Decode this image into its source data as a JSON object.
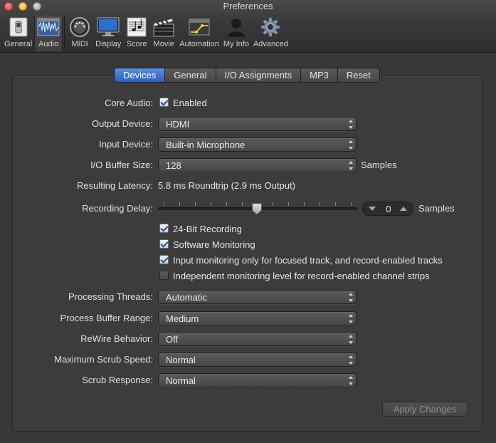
{
  "window": {
    "title": "Preferences"
  },
  "toolbar": {
    "items": [
      {
        "label": "General",
        "icon": "switch-icon"
      },
      {
        "label": "Audio",
        "icon": "audio-waveform-icon"
      },
      {
        "label": "MIDI",
        "icon": "midi-connector-icon"
      },
      {
        "label": "Display",
        "icon": "monitor-icon"
      },
      {
        "label": "Score",
        "icon": "music-score-icon"
      },
      {
        "label": "Movie",
        "icon": "clapperboard-icon"
      },
      {
        "label": "Automation",
        "icon": "automation-curve-icon"
      },
      {
        "label": "My Info",
        "icon": "person-icon"
      },
      {
        "label": "Advanced",
        "icon": "gear-icon"
      }
    ],
    "selected": "Audio"
  },
  "tabs": [
    "Devices",
    "General",
    "I/O Assignments",
    "MP3",
    "Reset"
  ],
  "active_tab": "Devices",
  "form": {
    "core_audio": {
      "label": "Core Audio:",
      "checkbox_label": "Enabled",
      "checked": true
    },
    "output_device": {
      "label": "Output Device:",
      "value": "HDMI"
    },
    "input_device": {
      "label": "Input Device:",
      "value": "Built-in Microphone"
    },
    "io_buffer": {
      "label": "I/O Buffer Size:",
      "value": "128",
      "unit": "Samples"
    },
    "latency": {
      "label": "Resulting Latency:",
      "value": "5.8 ms Roundtrip (2.9 ms Output)"
    },
    "recording_delay": {
      "label": "Recording Delay:",
      "value": "0",
      "unit": "Samples"
    },
    "options": [
      {
        "label": "24-Bit Recording",
        "checked": true
      },
      {
        "label": "Software Monitoring",
        "checked": true
      },
      {
        "label": "Input monitoring only for focused track, and record-enabled tracks",
        "checked": true
      },
      {
        "label": "Independent monitoring level for record-enabled channel strips",
        "checked": false
      }
    ],
    "processing_threads": {
      "label": "Processing Threads:",
      "value": "Automatic"
    },
    "process_buffer_range": {
      "label": "Process Buffer Range:",
      "value": "Medium"
    },
    "rewire_behavior": {
      "label": "ReWire Behavior:",
      "value": "Off"
    },
    "max_scrub_speed": {
      "label": "Maximum Scrub Speed:",
      "value": "Normal"
    },
    "scrub_response": {
      "label": "Scrub Response:",
      "value": "Normal"
    }
  },
  "apply_button": "Apply Changes"
}
